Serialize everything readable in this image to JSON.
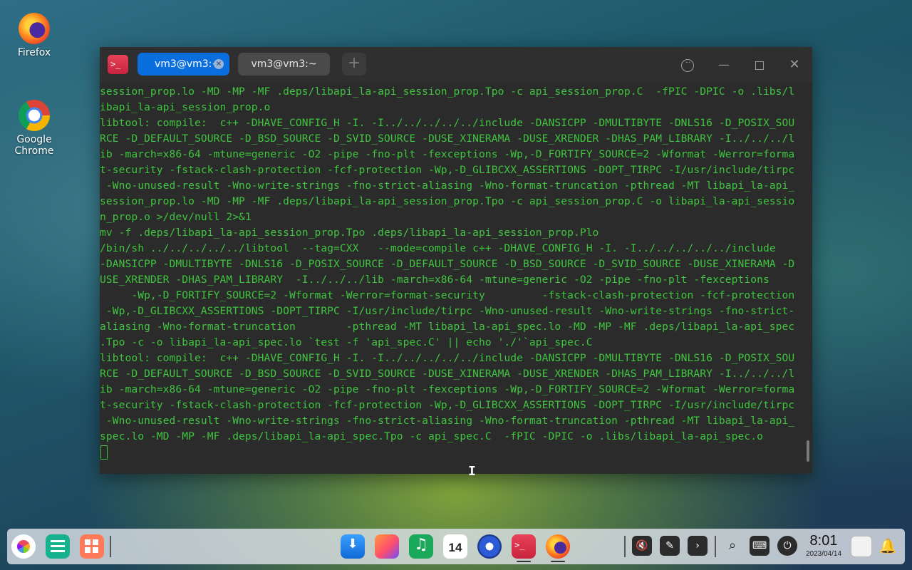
{
  "desktop": {
    "icons": [
      {
        "label": "Firefox"
      },
      {
        "label": "Google\nChrome"
      }
    ]
  },
  "terminal": {
    "tabs": [
      {
        "label": "vm3@vm3:~",
        "active": true
      },
      {
        "label": "vm3@vm3:~",
        "active": false
      }
    ],
    "new_tab": "+",
    "lines": [
      "session_prop.lo -MD -MP -MF .deps/libapi_la-api_session_prop.Tpo -c api_session_prop.C  -fPIC -DPIC -o .libs/l",
      "ibapi_la-api_session_prop.o",
      "libtool: compile:  c++ -DHAVE_CONFIG_H -I. -I../../../../../include -DANSICPP -DMULTIBYTE -DNLS16 -D_POSIX_SOU",
      "RCE -D_DEFAULT_SOURCE -D_BSD_SOURCE -D_SVID_SOURCE -DUSE_XINERAMA -DUSE_XRENDER -DHAS_PAM_LIBRARY -I../../../l",
      "ib -march=x86-64 -mtune=generic -O2 -pipe -fno-plt -fexceptions -Wp,-D_FORTIFY_SOURCE=2 -Wformat -Werror=forma",
      "t-security -fstack-clash-protection -fcf-protection -Wp,-D_GLIBCXX_ASSERTIONS -DOPT_TIRPC -I/usr/include/tirpc",
      " -Wno-unused-result -Wno-write-strings -fno-strict-aliasing -Wno-format-truncation -pthread -MT libapi_la-api_",
      "session_prop.lo -MD -MP -MF .deps/libapi_la-api_session_prop.Tpo -c api_session_prop.C -o libapi_la-api_sessio",
      "n_prop.o >/dev/null 2>&1",
      "mv -f .deps/libapi_la-api_session_prop.Tpo .deps/libapi_la-api_session_prop.Plo",
      "/bin/sh ../../../../../libtool  --tag=CXX   --mode=compile c++ -DHAVE_CONFIG_H -I. -I../../../../../include",
      "-DANSICPP -DMULTIBYTE -DNLS16 -D_POSIX_SOURCE -D_DEFAULT_SOURCE -D_BSD_SOURCE -D_SVID_SOURCE -DUSE_XINERAMA -D",
      "USE_XRENDER -DHAS_PAM_LIBRARY  -I../../../lib -march=x86-64 -mtune=generic -O2 -pipe -fno-plt -fexceptions",
      "     -Wp,-D_FORTIFY_SOURCE=2 -Wformat -Werror=format-security         -fstack-clash-protection -fcf-protection",
      " -Wp,-D_GLIBCXX_ASSERTIONS -DOPT_TIRPC -I/usr/include/tirpc -Wno-unused-result -Wno-write-strings -fno-strict-",
      "aliasing -Wno-format-truncation        -pthread -MT libapi_la-api_spec.lo -MD -MP -MF .deps/libapi_la-api_spec",
      ".Tpo -c -o libapi_la-api_spec.lo `test -f 'api_spec.C' || echo './'`api_spec.C",
      "libtool: compile:  c++ -DHAVE_CONFIG_H -I. -I../../../../../include -DANSICPP -DMULTIBYTE -DNLS16 -D_POSIX_SOU",
      "RCE -D_DEFAULT_SOURCE -D_BSD_SOURCE -D_SVID_SOURCE -DUSE_XINERAMA -DUSE_XRENDER -DHAS_PAM_LIBRARY -I../../../l",
      "ib -march=x86-64 -mtune=generic -O2 -pipe -fno-plt -fexceptions -Wp,-D_FORTIFY_SOURCE=2 -Wformat -Werror=forma",
      "t-security -fstack-clash-protection -fcf-protection -Wp,-D_GLIBCXX_ASSERTIONS -DOPT_TIRPC -I/usr/include/tirpc",
      " -Wno-unused-result -Wno-write-strings -fno-strict-aliasing -Wno-format-truncation -pthread -MT libapi_la-api_",
      "spec.lo -MD -MP -MF .deps/libapi_la-api_spec.Tpo -c api_spec.C  -fPIC -DPIC -o .libs/libapi_la-api_spec.o"
    ],
    "colors": {
      "text": "#3fc43f",
      "background": "#2b2b2b",
      "active_tab": "#0a6ede"
    }
  },
  "dock": {
    "calendar_day": "14",
    "clock_time": "8:01",
    "clock_date": "2023/04/14"
  }
}
